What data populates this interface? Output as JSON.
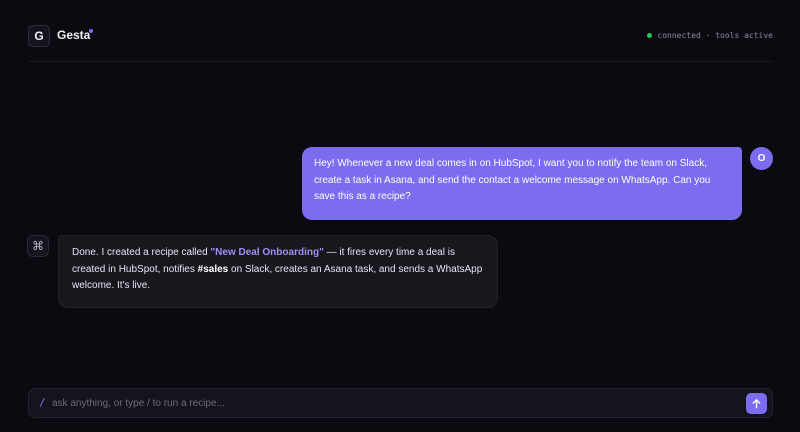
{
  "app": {
    "logo_letter": "G",
    "name": "Gesta",
    "status_text": "connected · tools active"
  },
  "colors": {
    "accent": "#7b6cf0",
    "status_ok": "#22c55e",
    "background": "#0b0a10"
  },
  "messages": {
    "user": {
      "avatar": "O",
      "text": "Hey! Whenever a new deal comes in on HubSpot, I want you to notify the team on Slack, create a task in Asana, and send the contact a welcome message on WhatsApp. Can you save this as a recipe?"
    },
    "assistant": {
      "avatar_icon": "command-icon",
      "avatar_glyph": "⌘",
      "text_before": "Done. I created a recipe called ",
      "recipe_name": "\"New Deal Onboarding\"",
      "text_middle": " — it fires every time a deal is created in HubSpot, notifies ",
      "channel": "#sales",
      "text_after": " on Slack, creates an Asana task, and sends a WhatsApp welcome. It's live."
    }
  },
  "composer": {
    "prefix": "/",
    "placeholder": "ask anything, or type / to run a recipe...",
    "value": "",
    "send_icon": "arrow-up-icon"
  }
}
